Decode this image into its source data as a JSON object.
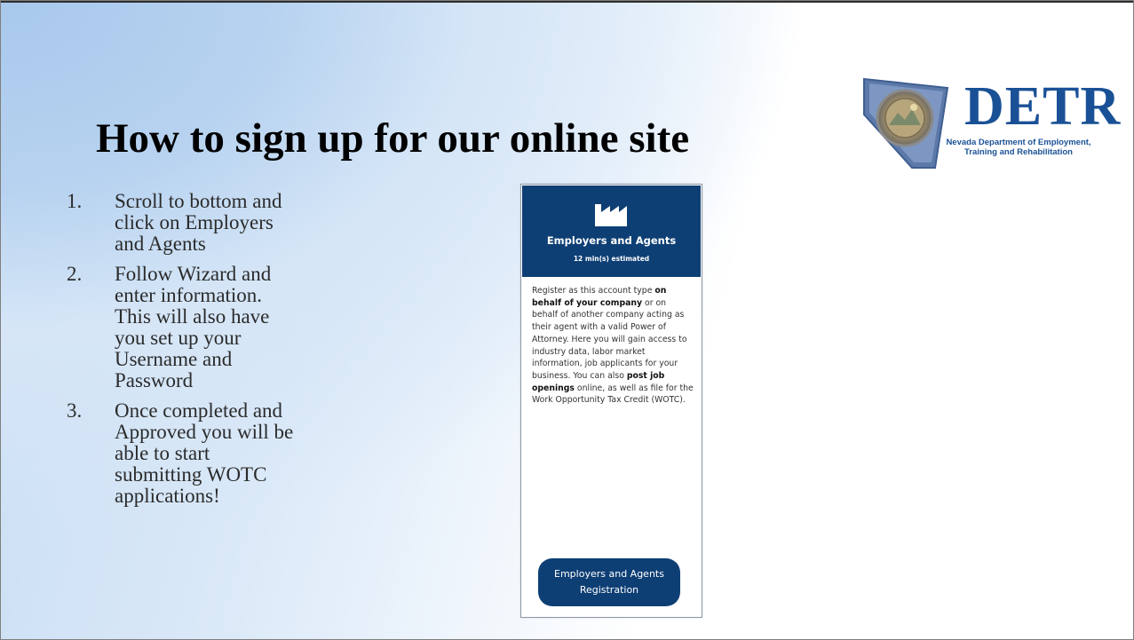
{
  "slide": {
    "title": "How to sign up for our online site",
    "logo": {
      "word": "DETR",
      "subtitle_line1": "Nevada Department of Employment,",
      "subtitle_line2": "Training and Rehabilitation",
      "icon": "nevada-seal-map-icon"
    },
    "steps": [
      {
        "num": "1.",
        "text": "Scroll to bottom and\nclick on Employers\nand Agents"
      },
      {
        "num": "2.",
        "text": "Follow Wizard and\nenter information.\nThis will also have\nyou set up your\nUsername and\nPassword"
      },
      {
        "num": "3.",
        "text": "Once completed and\nApproved you will be\nable to start\nsubmitting WOTC\napplications!"
      }
    ]
  },
  "card": {
    "icon": "factory-icon",
    "title": "Employers and Agents",
    "estimate": "12 min(s) estimated",
    "body": {
      "p1": "Register as this account type ",
      "b1": "on behalf of your company",
      "p2": " or on behalf of another company acting as their agent with a valid Power of Attorney. Here you will gain access to industry data, labor market information, job applicants for your business. You can also ",
      "b2": "post job openings",
      "p3": " online, as well as file for the Work Opportunity Tax Credit (WOTC)."
    },
    "button_label": "Employers and Agents\nRegistration"
  },
  "colors": {
    "card_header": "#0e3f74",
    "logo_blue": "#1a5196",
    "background_blue": "#a8c8ec"
  }
}
